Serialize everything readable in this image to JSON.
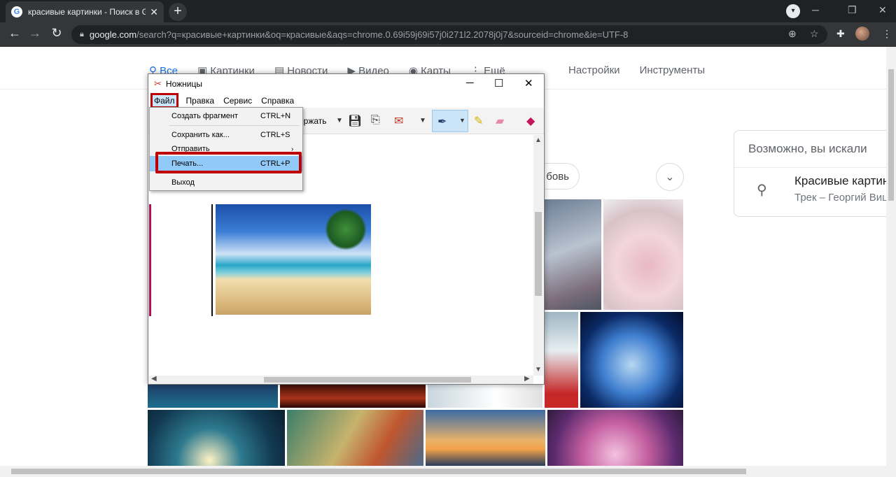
{
  "browser": {
    "tab_title": "красивые картинки - Поиск в Google",
    "tab_close": "✕",
    "new_tab": "+",
    "url_host": "google.com",
    "url_path": "/search?q=красивые+картинки&oq=красивые&aqs=chrome.0.69i59j69i57j0i271l2.2078j0j7&sourceid=chrome&ie=UTF-8"
  },
  "google": {
    "nav": [
      {
        "label": "Все",
        "icon": "search-icon"
      },
      {
        "label": "Картинки",
        "icon": "image-icon"
      },
      {
        "label": "Новости",
        "icon": "news-icon"
      },
      {
        "label": "Видео",
        "icon": "video-icon"
      },
      {
        "label": "Карты",
        "icon": "map-pin-icon"
      },
      {
        "label": "Ещё",
        "icon": "more-icon"
      }
    ],
    "settings": "Настройки",
    "tools": "Инструменты",
    "chip_label": "бовь",
    "side_card": {
      "heading": "Возможно, вы искали",
      "title": "Красивые картинки",
      "subtitle": "Трек – Георгий Вицин"
    }
  },
  "snip": {
    "title": "Ножницы",
    "menu": [
      "Файл",
      "Правка",
      "Сервис",
      "Справка"
    ],
    "toolbar_partial_label": "ержать",
    "dropdown": [
      {
        "label": "Создать фрагмент",
        "shortcut": "CTRL+N"
      },
      {
        "label": "Сохранить как...",
        "shortcut": "CTRL+S"
      },
      {
        "label": "Отправить",
        "shortcut": ""
      },
      {
        "label": "Печать...",
        "shortcut": "CTRL+P"
      },
      {
        "label": "Выход",
        "shortcut": ""
      }
    ]
  },
  "colors": {
    "highlight_red": "#c00000",
    "link_blue": "#1a73e8",
    "menu_highlight": "#91c9f7"
  }
}
